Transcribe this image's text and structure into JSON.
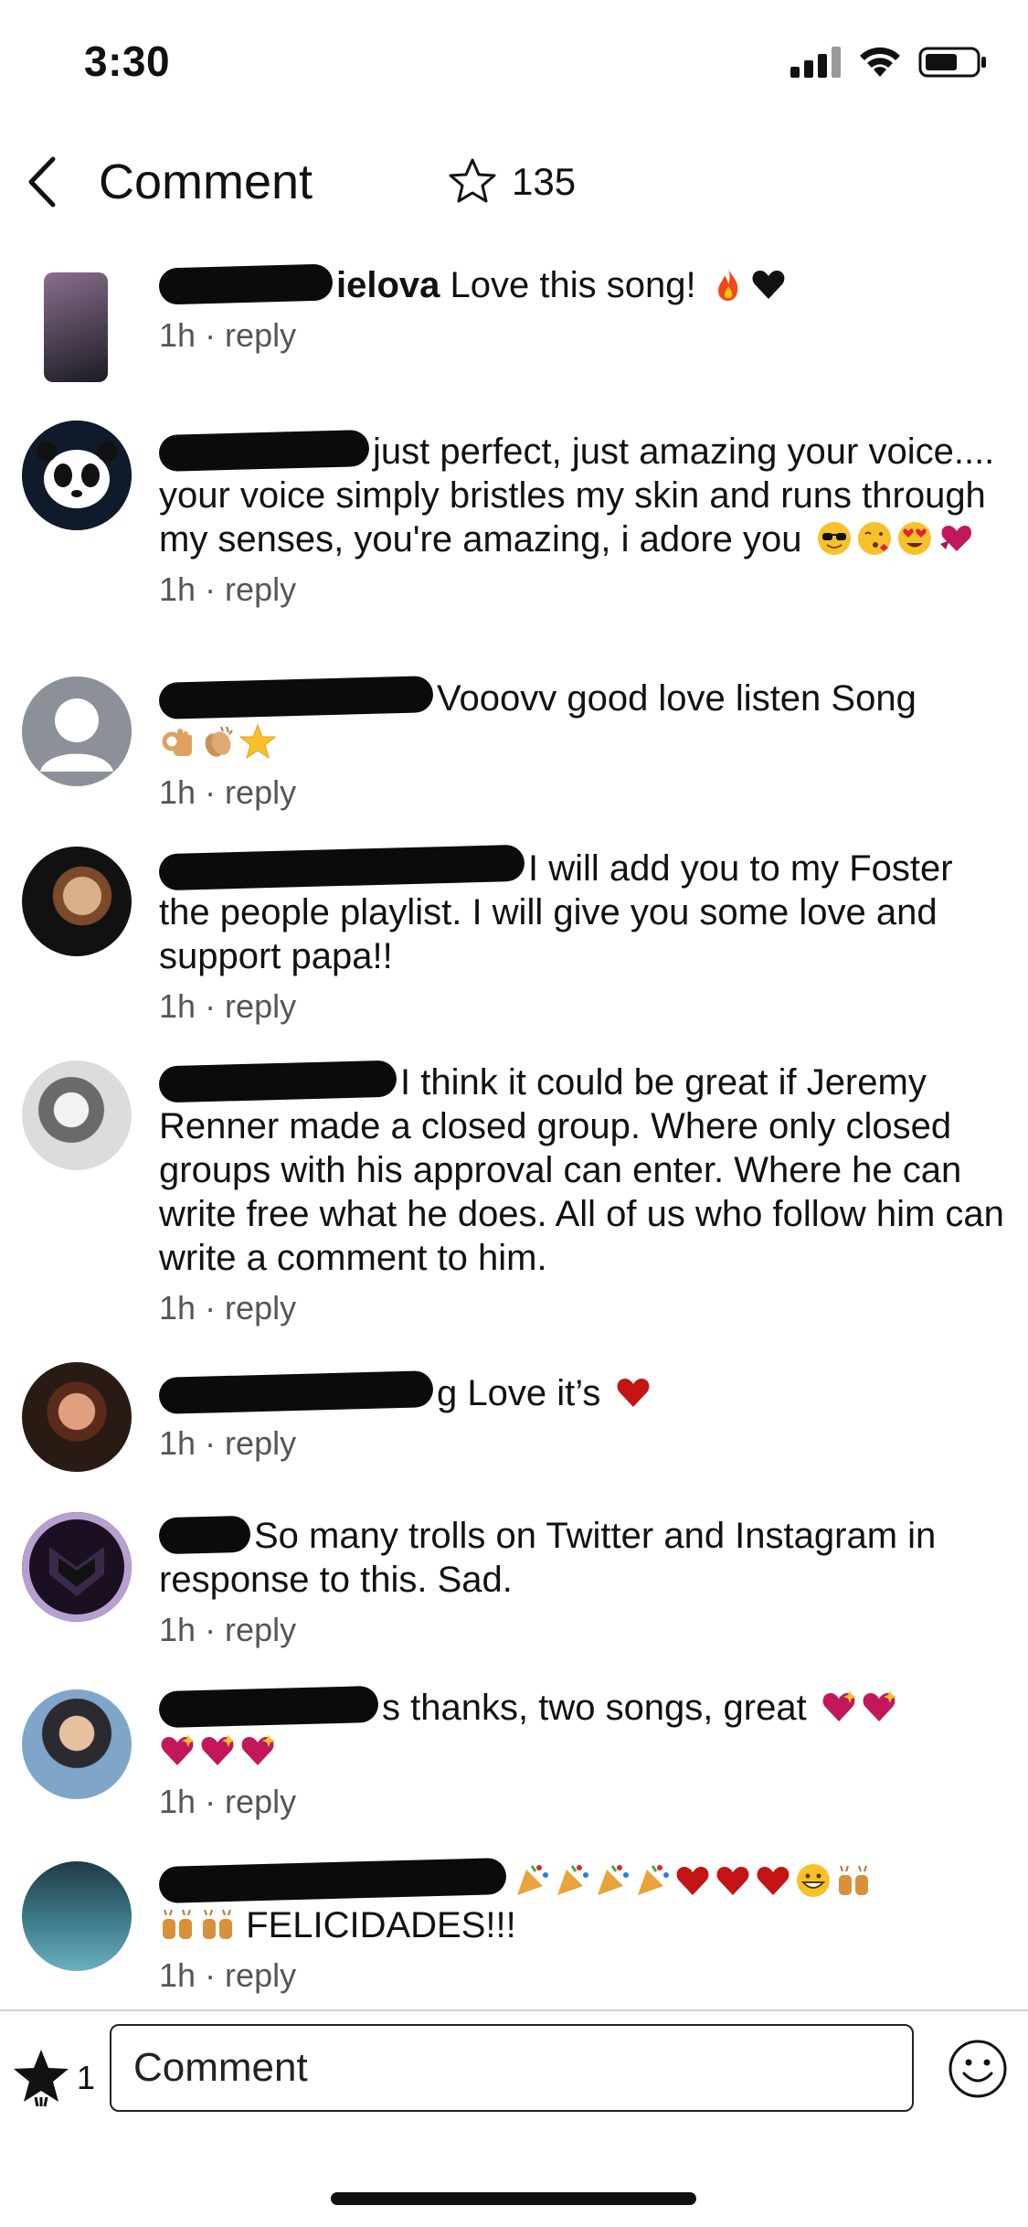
{
  "status": {
    "time": "3:30"
  },
  "header": {
    "title": "Comment",
    "stars": "135"
  },
  "comments": [
    {
      "name_tail": "ielova",
      "text": "Love this song!",
      "time": "1h",
      "reply": "· reply",
      "avatar_colors": [
        "#6b5b7a",
        "#1b1b22"
      ]
    },
    {
      "name_tail": "",
      "text": "just perfect, just amazing your voice.... your voice simply bristles my skin and runs through my senses, you're amazing, i adore you",
      "time": "1h",
      "reply": "· reply",
      "avatar_colors": [
        "#0f1a2a",
        "#ffffff"
      ]
    },
    {
      "name_tail": "",
      "text": "Vooovv good love listen Song",
      "time": "1h",
      "reply": "· reply",
      "avatar_colors": [
        "#8c9099",
        "#ffffff"
      ]
    },
    {
      "name_tail": "",
      "text": "I will add you to my Foster the people playlist. I will give you some love and support papa!!",
      "time": "1h",
      "reply": "· reply",
      "avatar_colors": [
        "#1a1a1a",
        "#c9a37a"
      ]
    },
    {
      "name_tail": "",
      "text": "I think it could be great if Jeremy Renner made a closed group. Where only closed groups with his approval can enter. Where he can write free what he does. All of us who follow him can write a comment to him.",
      "time": "1h",
      "reply": "· reply",
      "avatar_colors": [
        "#d9d9d9",
        "#555555"
      ]
    },
    {
      "name_tail": "g",
      "text": "Love it’s",
      "time": "1h",
      "reply": "· reply",
      "avatar_colors": [
        "#3a2a24",
        "#c07a5a"
      ]
    },
    {
      "name_tail": "",
      "text": "So many trolls on Twitter and Instagram in response to this. Sad.",
      "time": "1h",
      "reply": "· reply",
      "avatar_colors": [
        "#2a1b3a",
        "#b79fd0"
      ]
    },
    {
      "name_tail": "s",
      "text": "thanks, two songs, great",
      "time": "1h",
      "reply": "· reply",
      "avatar_colors": [
        "#2f2f35",
        "#7fa6c8"
      ]
    },
    {
      "name_tail": "",
      "text": "FELICIDADES!!!",
      "time": "1h",
      "reply": "· reply",
      "avatar_colors": [
        "#1e3a45",
        "#6ab0c0"
      ]
    }
  ],
  "footer": {
    "star_count": "1",
    "input_placeholder": "Comment"
  }
}
